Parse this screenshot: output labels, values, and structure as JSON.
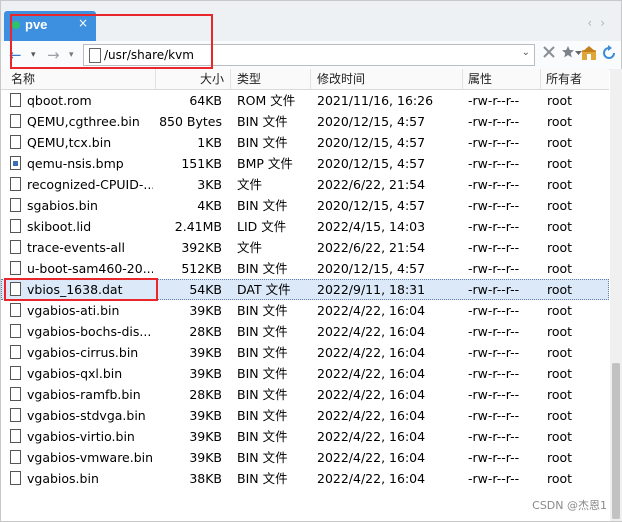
{
  "tab": {
    "label": "pve",
    "close": "×"
  },
  "tab_nav": {
    "left": "‹",
    "right": "›"
  },
  "toolbar": {
    "back": "←",
    "back_dd": "▾",
    "forward": "→",
    "forward_dd": "▾",
    "address": "/usr/share/kvm",
    "address_dd": "⌄"
  },
  "columns": {
    "name": "名称",
    "size": "大小",
    "type": "类型",
    "modified": "修改时间",
    "attributes": "属性",
    "owner": "所有者"
  },
  "files": [
    {
      "name": "qboot.rom",
      "size": "64KB",
      "type": "ROM 文件",
      "modified": "2021/11/16, 16:26",
      "attr": "-rw-r--r--",
      "owner": "root",
      "icon": "file-icon"
    },
    {
      "name": "QEMU,cgthree.bin",
      "size": "850 Bytes",
      "type": "BIN 文件",
      "modified": "2020/12/15, 4:57",
      "attr": "-rw-r--r--",
      "owner": "root",
      "icon": "file-icon"
    },
    {
      "name": "QEMU,tcx.bin",
      "size": "1KB",
      "type": "BIN 文件",
      "modified": "2020/12/15, 4:57",
      "attr": "-rw-r--r--",
      "owner": "root",
      "icon": "file-icon"
    },
    {
      "name": "qemu-nsis.bmp",
      "size": "151KB",
      "type": "BMP 文件",
      "modified": "2020/12/15, 4:57",
      "attr": "-rw-r--r--",
      "owner": "root",
      "icon": "image-file-icon"
    },
    {
      "name": "recognized-CPUID-...",
      "size": "3KB",
      "type": "文件",
      "modified": "2022/6/22, 21:54",
      "attr": "-rw-r--r--",
      "owner": "root",
      "icon": "file-icon"
    },
    {
      "name": "sgabios.bin",
      "size": "4KB",
      "type": "BIN 文件",
      "modified": "2020/12/15, 4:57",
      "attr": "-rw-r--r--",
      "owner": "root",
      "icon": "file-icon"
    },
    {
      "name": "skiboot.lid",
      "size": "2.41MB",
      "type": "LID 文件",
      "modified": "2022/4/15, 14:03",
      "attr": "-rw-r--r--",
      "owner": "root",
      "icon": "file-icon"
    },
    {
      "name": "trace-events-all",
      "size": "392KB",
      "type": "文件",
      "modified": "2022/6/22, 21:54",
      "attr": "-rw-r--r--",
      "owner": "root",
      "icon": "file-icon"
    },
    {
      "name": "u-boot-sam460-20...",
      "size": "512KB",
      "type": "BIN 文件",
      "modified": "2020/12/15, 4:57",
      "attr": "-rw-r--r--",
      "owner": "root",
      "icon": "file-icon"
    },
    {
      "name": "vbios_1638.dat",
      "size": "54KB",
      "type": "DAT 文件",
      "modified": "2022/9/11, 18:31",
      "attr": "-rw-r--r--",
      "owner": "root",
      "icon": "file-icon",
      "selected": true
    },
    {
      "name": "vgabios-ati.bin",
      "size": "39KB",
      "type": "BIN 文件",
      "modified": "2022/4/22, 16:04",
      "attr": "-rw-r--r--",
      "owner": "root",
      "icon": "file-icon"
    },
    {
      "name": "vgabios-bochs-dis...",
      "size": "28KB",
      "type": "BIN 文件",
      "modified": "2022/4/22, 16:04",
      "attr": "-rw-r--r--",
      "owner": "root",
      "icon": "file-icon"
    },
    {
      "name": "vgabios-cirrus.bin",
      "size": "39KB",
      "type": "BIN 文件",
      "modified": "2022/4/22, 16:04",
      "attr": "-rw-r--r--",
      "owner": "root",
      "icon": "file-icon"
    },
    {
      "name": "vgabios-qxl.bin",
      "size": "39KB",
      "type": "BIN 文件",
      "modified": "2022/4/22, 16:04",
      "attr": "-rw-r--r--",
      "owner": "root",
      "icon": "file-icon"
    },
    {
      "name": "vgabios-ramfb.bin",
      "size": "28KB",
      "type": "BIN 文件",
      "modified": "2022/4/22, 16:04",
      "attr": "-rw-r--r--",
      "owner": "root",
      "icon": "file-icon"
    },
    {
      "name": "vgabios-stdvga.bin",
      "size": "39KB",
      "type": "BIN 文件",
      "modified": "2022/4/22, 16:04",
      "attr": "-rw-r--r--",
      "owner": "root",
      "icon": "file-icon"
    },
    {
      "name": "vgabios-virtio.bin",
      "size": "39KB",
      "type": "BIN 文件",
      "modified": "2022/4/22, 16:04",
      "attr": "-rw-r--r--",
      "owner": "root",
      "icon": "file-icon"
    },
    {
      "name": "vgabios-vmware.bin",
      "size": "39KB",
      "type": "BIN 文件",
      "modified": "2022/4/22, 16:04",
      "attr": "-rw-r--r--",
      "owner": "root",
      "icon": "file-icon"
    },
    {
      "name": "vgabios.bin",
      "size": "38KB",
      "type": "BIN 文件",
      "modified": "2022/4/22, 16:04",
      "attr": "-rw-r--r--",
      "owner": "root",
      "icon": "file-icon"
    }
  ],
  "watermark": "CSDN @杰恩1",
  "colors": {
    "tab": "#3d8fe0",
    "selection": "#dbe9f8",
    "annotation": "#e8262b"
  }
}
